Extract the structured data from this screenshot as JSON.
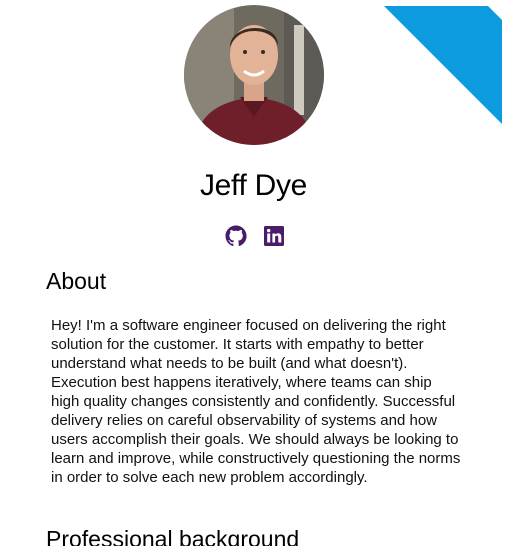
{
  "colors": {
    "accent": "#0d9be0",
    "icon": "#4a1a6b",
    "text": "#111111"
  },
  "profile": {
    "name": "Jeff Dye",
    "avatar_icon": "profile-photo"
  },
  "socials": [
    {
      "icon": "github-icon"
    },
    {
      "icon": "linkedin-icon"
    }
  ],
  "about": {
    "heading": "About",
    "text": "Hey! I'm a software engineer focused on delivering the right solution for the customer. It starts with empathy to better understand what needs to be built (and what doesn't). Execution best happens iteratively, where teams can ship high quality changes consistently and confidently. Successful delivery relies on careful observability of systems and how users accomplish their goals. We should always be looking to learn and improve, while constructively questioning the norms in order to solve each new problem accordingly."
  },
  "professional": {
    "heading": "Professional background"
  }
}
